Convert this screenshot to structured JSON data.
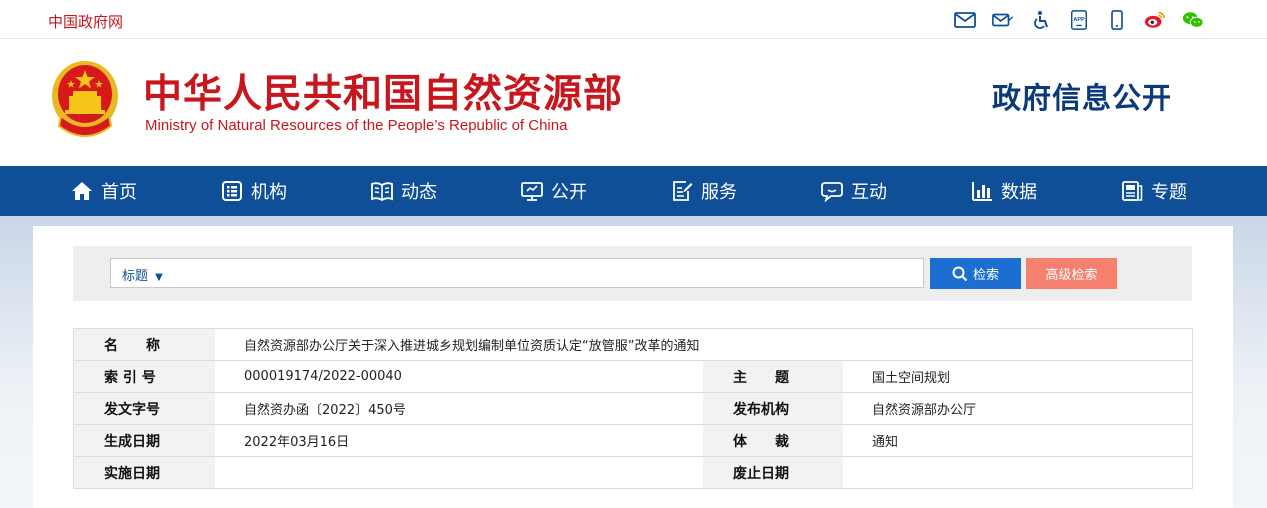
{
  "topbar": {
    "gov_link": "中国政府网",
    "icons": [
      "mail-icon",
      "mail-edit-icon",
      "accessibility-icon",
      "app-icon",
      "mobile-icon",
      "weibo-icon",
      "wechat-icon"
    ],
    "app_label": "APP"
  },
  "header": {
    "title_cn": "中华人民共和国自然资源部",
    "title_en": "Ministry of Natural Resources of the People’s Republic of China",
    "section_title": "政府信息公开"
  },
  "nav": {
    "items": [
      {
        "label": "首页",
        "icon": "home-icon"
      },
      {
        "label": "机构",
        "icon": "org-icon"
      },
      {
        "label": "动态",
        "icon": "book-icon"
      },
      {
        "label": "公开",
        "icon": "monitor-icon"
      },
      {
        "label": "服务",
        "icon": "edit-doc-icon"
      },
      {
        "label": "互动",
        "icon": "chat-icon"
      },
      {
        "label": "数据",
        "icon": "bar-chart-icon"
      },
      {
        "label": "专题",
        "icon": "topic-icon"
      }
    ]
  },
  "search": {
    "type_label": "标题",
    "value": "",
    "search_label": "检索",
    "advanced_label": "高级检索"
  },
  "info": {
    "name_label": "名　　称",
    "name_value": "自然资源部办公厅关于深入推进城乡规划编制单位资质认定“放管服”改革的通知",
    "index_label": "索 引 号",
    "index_value": "000019174/2022-00040",
    "subject_label": "主　　题",
    "subject_value": "国土空间规划",
    "docno_label": "发文字号",
    "docno_value": "自然资办函〔2022〕450号",
    "issuer_label": "发布机构",
    "issuer_value": "自然资源部办公厅",
    "date_label": "生成日期",
    "date_value": "2022年03月16日",
    "genre_label": "体　　裁",
    "genre_value": "通知",
    "effective_label": "实施日期",
    "effective_value": "",
    "expiry_label": "废止日期",
    "expiry_value": ""
  },
  "colors": {
    "brand_red": "#c8161d",
    "nav_blue": "#0e4f98",
    "search_blue": "#1c6fd1",
    "advanced_salmon": "#f4806d"
  }
}
